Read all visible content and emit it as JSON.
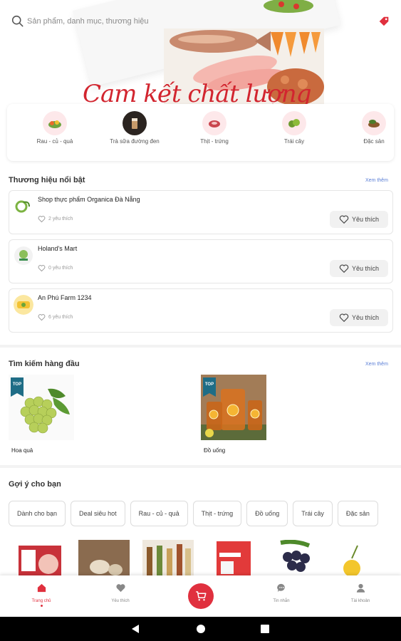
{
  "search": {
    "placeholder": "Sản phẩm, danh mục, thương hiệu"
  },
  "hero": {
    "slogan": "Cam kết chất lượng"
  },
  "categories": [
    {
      "label": "Rau - củ - quả",
      "icon": "vegetables-icon"
    },
    {
      "label": "Trà sữa đường đen",
      "icon": "milk-tea-icon"
    },
    {
      "label": "Thịt - trứng",
      "icon": "meat-icon"
    },
    {
      "label": "Trái cây",
      "icon": "fruit-icon"
    },
    {
      "label": "Đặc sản",
      "icon": "specialty-icon"
    }
  ],
  "featured_brands": {
    "title": "Thương hiệu nổi bật",
    "see_more": "Xem thêm",
    "items": [
      {
        "name": "Shop thực phẩm Organica Đà Nẵng",
        "likes": "2 yêu thích",
        "button": "Yêu thích"
      },
      {
        "name": "Holand's Mart",
        "likes": "0 yêu thích",
        "button": "Yêu thích"
      },
      {
        "name": "An Phú Farm 1234",
        "likes": "6 yêu thích",
        "button": "Yêu thích"
      }
    ]
  },
  "top_searches": {
    "title": "Tìm kiếm hàng đầu",
    "see_more": "Xem thêm",
    "badge": "TOP",
    "items": [
      {
        "label": "Hoa quả"
      },
      {
        "label": "Đồ uống"
      }
    ]
  },
  "suggestions": {
    "title": "Gợi ý cho bạn",
    "chips": [
      "Dành cho bạn",
      "Deal siêu hot",
      "Rau - củ - quả",
      "Thịt - trứng",
      "Đồ uống",
      "Trái cây",
      "Đặc sản"
    ]
  },
  "bottom_nav": [
    {
      "label": "Trang chủ",
      "icon": "home-icon",
      "active": true
    },
    {
      "label": "Yêu thích",
      "icon": "heart-icon",
      "active": false
    },
    {
      "label": "",
      "icon": "cart-icon",
      "active": false
    },
    {
      "label": "Tin nhắn",
      "icon": "chat-icon",
      "active": false
    },
    {
      "label": "Tài khoản",
      "icon": "account-icon",
      "active": false
    }
  ],
  "colors": {
    "accent": "#e0303e",
    "link": "#5b7fd6",
    "badge": "#1f6d86"
  }
}
